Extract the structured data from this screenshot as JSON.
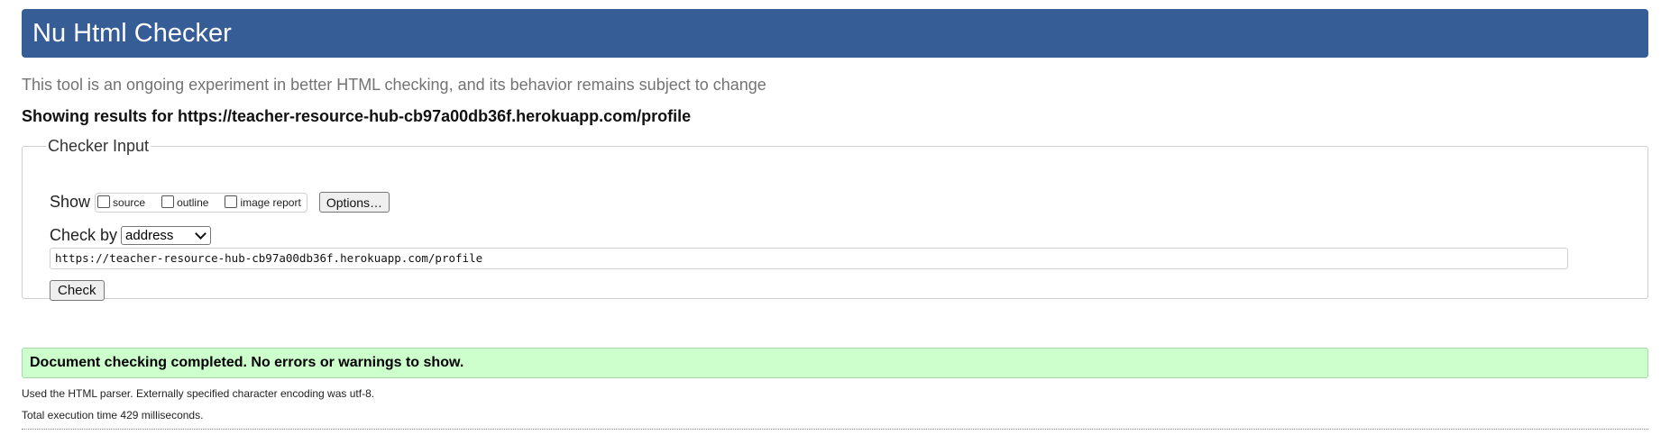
{
  "header": {
    "title": "Nu Html Checker"
  },
  "intro_text": "This tool is an ongoing experiment in better HTML checking, and its behavior remains subject to change",
  "results_for": "Showing results for https://teacher-resource-hub-cb97a00db36f.herokuapp.com/profile",
  "checker_input": {
    "legend": "Checker Input",
    "show_label": "Show",
    "checkboxes": [
      {
        "label": "source",
        "checked": false
      },
      {
        "label": "outline",
        "checked": false
      },
      {
        "label": "image report",
        "checked": false
      }
    ],
    "options_button": "Options…",
    "check_by_label": "Check by",
    "check_by_selected": "address",
    "url_value": "https://teacher-resource-hub-cb97a00db36f.herokuapp.com/profile",
    "check_button": "Check"
  },
  "result": {
    "success_message": "Document checking completed. No errors or warnings to show.",
    "parser_info": "Used the HTML parser. Externally specified character encoding was utf-8.",
    "execution_time": "Total execution time 429 milliseconds."
  },
  "colors": {
    "header_bg": "#365d95",
    "success_bg": "#ccffcc"
  }
}
